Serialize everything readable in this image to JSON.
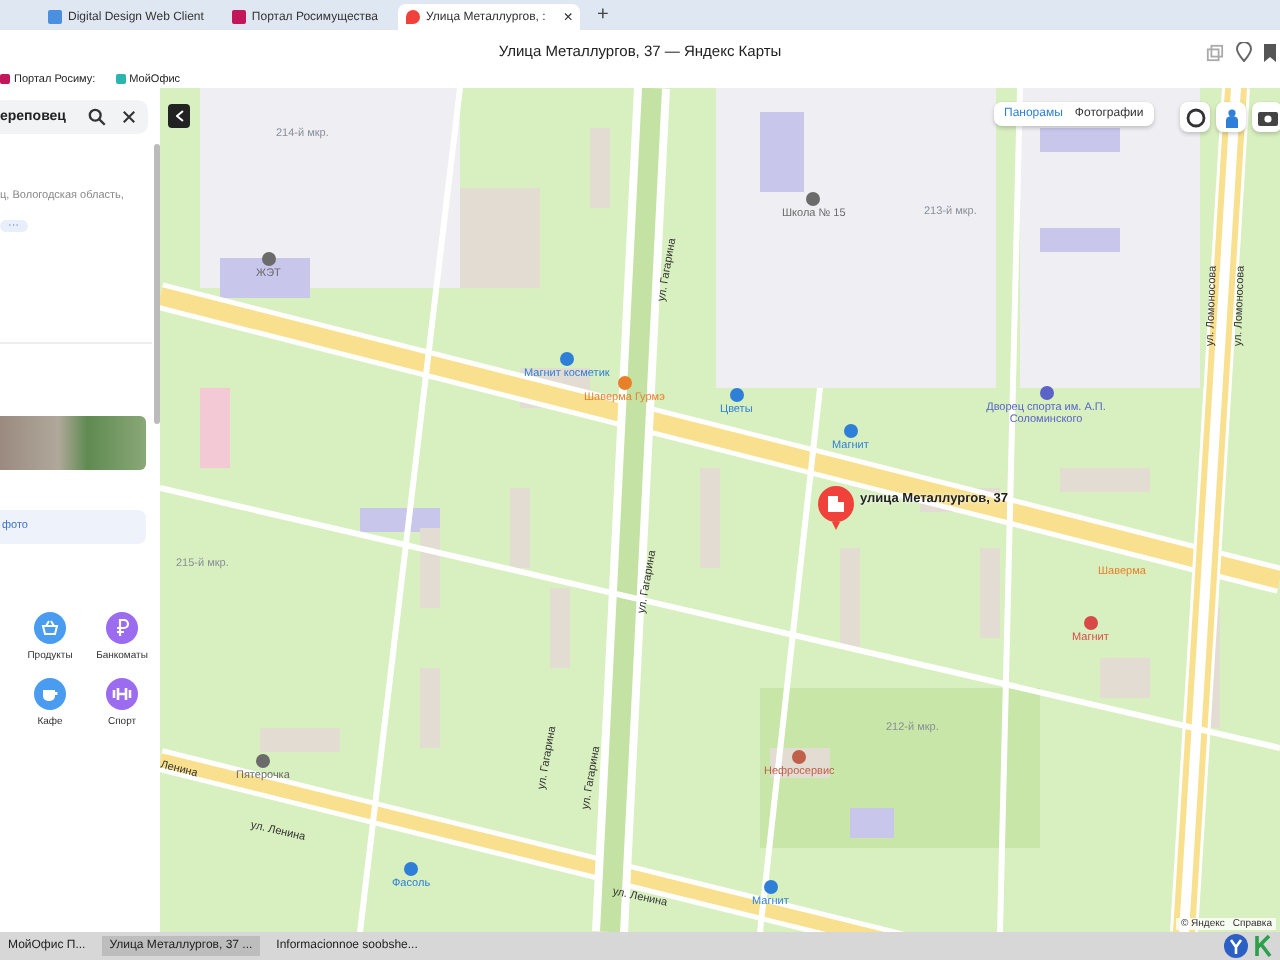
{
  "browser": {
    "tabs": [
      {
        "label": "Digital Design Web Client",
        "selected": false
      },
      {
        "label": "Портал Росимущества",
        "selected": false
      },
      {
        "label": "Улица Металлургов, :",
        "selected": true
      }
    ],
    "close_tab": "×",
    "new_tab": "+",
    "title": "Улица Металлургов, 37 — Яндекс Карты",
    "bookmarks": [
      "Портал Росиму:",
      "МойОфис"
    ]
  },
  "sidebar": {
    "search": {
      "value": "ереповец"
    },
    "address": "ц, Вологодская область,",
    "more": "···",
    "photo_button": "фото",
    "categories": [
      {
        "label": "Продукты",
        "color": "#4a9cf0"
      },
      {
        "label": "Банкоматы",
        "color": "#9c6cf0"
      },
      {
        "label": "Кафе",
        "color": "#4a9cf0"
      },
      {
        "label": "Спорт",
        "color": "#9c6cf0"
      }
    ]
  },
  "map": {
    "layers": [
      {
        "label": "Панорамы",
        "selected": true
      },
      {
        "label": "Фотографии",
        "selected": false
      }
    ],
    "labels": [
      {
        "kind": "district",
        "text": "214-й мкр."
      },
      {
        "kind": "poi",
        "text": "Школа № 15",
        "color": "#6b6b6b"
      },
      {
        "kind": "district",
        "text": "213-й мкр."
      },
      {
        "kind": "poi",
        "text": "ЖЭТ",
        "color": "#6b6b6b"
      },
      {
        "kind": "street",
        "text": "ул. Гагарина"
      },
      {
        "kind": "street",
        "text": "ул. Ломоносова"
      },
      {
        "kind": "street",
        "text": "ул. Ломоносова"
      },
      {
        "kind": "poi",
        "text": "Магнит косметик",
        "color": "#2d7fd8"
      },
      {
        "kind": "poi",
        "text": "Шаверма Гурмэ",
        "color": "#e8802a"
      },
      {
        "kind": "poi",
        "text": "Цветы",
        "color": "#2d7fd8"
      },
      {
        "kind": "poi",
        "text": "Дворец спорта им. А.П. Соломинского",
        "color": "#5b63c8"
      },
      {
        "kind": "poi",
        "text": "Магнит",
        "color": "#2d7fd8"
      },
      {
        "kind": "marker",
        "text": "улица Металлургов, 37"
      },
      {
        "kind": "district",
        "text": "215-й мкр."
      },
      {
        "kind": "street",
        "text": "ул. Гагарина"
      },
      {
        "kind": "label",
        "text": "Шаверма",
        "color": "#e8802a"
      },
      {
        "kind": "poi",
        "text": "Магнит",
        "color": "#d84a4a"
      },
      {
        "kind": "district",
        "text": "212-й мкр."
      },
      {
        "kind": "poi",
        "text": "Пятерочка",
        "color": "#6b6b6b"
      },
      {
        "kind": "poi",
        "text": "Нефросервис",
        "color": "#c0604a"
      },
      {
        "kind": "street",
        "text": "Ленина"
      },
      {
        "kind": "street",
        "text": "ул. Гагарина"
      },
      {
        "kind": "street",
        "text": "ул. Гагарина"
      },
      {
        "kind": "street",
        "text": "ул. Ленина"
      },
      {
        "kind": "street",
        "text": "ул. Ленина"
      },
      {
        "kind": "poi",
        "text": "Фасоль",
        "color": "#2d7fd8"
      },
      {
        "kind": "poi",
        "text": "Магнит",
        "color": "#2d7fd8"
      }
    ],
    "copyright": "© Яндекс",
    "help": "Справка"
  },
  "taskbar": [
    {
      "label": "МойОфис П...",
      "selected": false
    },
    {
      "label": "Улица Металлургов, 37 ...",
      "selected": true
    },
    {
      "label": "Informacionnoe soobshe...",
      "selected": false
    }
  ]
}
